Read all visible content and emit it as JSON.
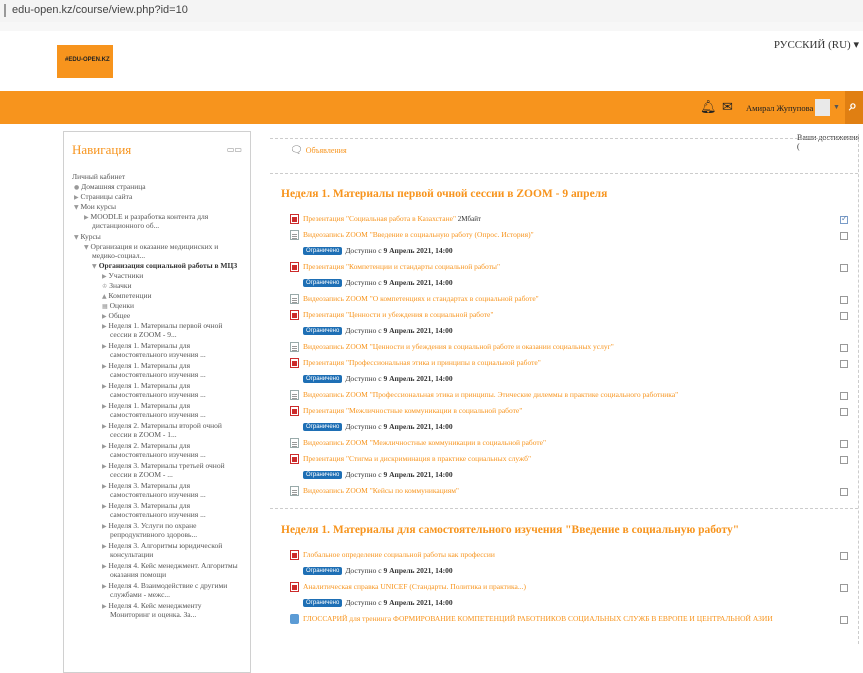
{
  "browser": {
    "url": "edu-open.kz/course/view.php?id=10"
  },
  "header": {
    "logo_text": "#EDU-OPEN.KZ",
    "language": "РУССКИЙ (RU) ▾"
  },
  "navbar": {
    "user_name": "Амирал Жупупова",
    "colors": {
      "accent": "#f7941d"
    }
  },
  "nav": {
    "title": "Навигация",
    "items": [
      {
        "label": "Личный кабинет",
        "arrow": ""
      },
      {
        "label": "Домашняя страница",
        "arrow": "●"
      },
      {
        "label": "Страницы сайта",
        "arrow": "▶"
      },
      {
        "label": "Мои курсы",
        "arrow": "▼"
      },
      {
        "label": "MOODLE и разработка контента для",
        "arrow": "▶"
      },
      {
        "label": "дистанционного об...",
        "arrow": ""
      },
      {
        "label": "Курсы",
        "arrow": "▼"
      },
      {
        "label": "Организация и оказание медицинских и",
        "arrow": "▼"
      },
      {
        "label": "медико-социал...",
        "arrow": ""
      },
      {
        "label": "Организация социальной работы в МЦЗ",
        "arrow": "▼"
      },
      {
        "label": "Участники",
        "arrow": "▶"
      },
      {
        "label": "Значки",
        "arrow": "♔"
      },
      {
        "label": "Компетенции",
        "arrow": "▲"
      },
      {
        "label": "Оценки",
        "arrow": "▦"
      },
      {
        "label": "Общее",
        "arrow": "▶"
      },
      {
        "label": "Неделя 1. Материалы первой очной",
        "arrow": "▶"
      },
      {
        "label": "сессии в ZOOM - 9...",
        "arrow": ""
      },
      {
        "label": "Неделя 1. Материалы для",
        "arrow": "▶"
      },
      {
        "label": "самостоятельного изучения ...",
        "arrow": ""
      },
      {
        "label": "Неделя 1. Материалы для",
        "arrow": "▶"
      },
      {
        "label": "самостоятельного изучения ...",
        "arrow": ""
      },
      {
        "label": "Неделя 1. Материалы для",
        "arrow": "▶"
      },
      {
        "label": "самостоятельного изучения ...",
        "arrow": ""
      },
      {
        "label": "Неделя 1. Материалы для",
        "arrow": "▶"
      },
      {
        "label": "самостоятельного изучения ...",
        "arrow": ""
      },
      {
        "label": "Неделя 2. Материалы второй очной",
        "arrow": "▶"
      },
      {
        "label": "сессии в ZOOM - 1...",
        "arrow": ""
      },
      {
        "label": "Неделя 2. Материалы для",
        "arrow": "▶"
      },
      {
        "label": "самостоятельного изучения ...",
        "arrow": ""
      },
      {
        "label": "Неделя 3. Материалы третьей очной",
        "arrow": "▶"
      },
      {
        "label": "сессии в ZOOM - ...",
        "arrow": ""
      },
      {
        "label": "Неделя 3. Материалы для",
        "arrow": "▶"
      },
      {
        "label": "самостоятельного изучения ...",
        "arrow": ""
      },
      {
        "label": "Неделя 3. Материалы для",
        "arrow": "▶"
      },
      {
        "label": "самостоятельного изучения ...",
        "arrow": ""
      },
      {
        "label": "Неделя 3. Услуги по охране",
        "arrow": "▶"
      },
      {
        "label": "репродуктивного здоровь...",
        "arrow": ""
      },
      {
        "label": "Неделя 3. Алгоритмы юридической",
        "arrow": "▶"
      },
      {
        "label": "консультации",
        "arrow": ""
      },
      {
        "label": "Неделя 4. Кейс менеджмент. Алгоритмы",
        "arrow": "▶"
      },
      {
        "label": "оказания помощи",
        "arrow": ""
      },
      {
        "label": "Неделя 4. Взаимодействие с другими",
        "arrow": "▶"
      },
      {
        "label": "службами - межс...",
        "arrow": ""
      },
      {
        "label": "Неделя 4. Кейс менеджменту",
        "arrow": "▶"
      },
      {
        "label": "Мониторинг и оценка. За...",
        "arrow": ""
      }
    ]
  },
  "main": {
    "achievements": "Ваши достижения (",
    "announcements": "Объявления",
    "sections": [
      {
        "title": "Неделя 1. Материалы первой очной сессии в ZOOM - 9 апреля",
        "activities": [
          {
            "icon": "pdf",
            "label": "Презентация \"Социальная работа в Казахстане\"",
            "size": "2Мбайт",
            "checked": true,
            "restricted": false
          },
          {
            "icon": "doc",
            "label": "Видеозапись ZOOM \"Введение в социальную работу (Опрос. История)\"",
            "checked": false,
            "restricted": true
          },
          {
            "icon": "pdf",
            "label": "Презентация \"Компетенции и стандарты социальной работы\"",
            "checked": false,
            "restricted": true
          },
          {
            "icon": "doc",
            "label": "Видеозапись ZOOM \"О компетенциях и стандартах в социальной работе\"",
            "checked": false,
            "restricted": false
          },
          {
            "icon": "pdf",
            "label": "Презентация \"Ценности и убеждения в социальной работе\"",
            "checked": false,
            "restricted": true
          },
          {
            "icon": "doc",
            "label": "Видеозапись ZOOM \"Ценности и убеждения в социальной работе и оказании социальных услуг\"",
            "checked": false,
            "restricted": false
          },
          {
            "icon": "pdf",
            "label": "Презентация \"Профессиональная этика и принципы в социальной работе\"",
            "checked": false,
            "restricted": true
          },
          {
            "icon": "doc",
            "label": "Видеозапись ZOOM \"Профессиональная этика и принципы. Этические дилеммы в практике социального работника\"",
            "checked": false,
            "restricted": false
          },
          {
            "icon": "pdf",
            "label": "Презентация \"Межличностные коммуникации в социальной работе\"",
            "checked": false,
            "restricted": true
          },
          {
            "icon": "doc",
            "label": "Видеозапись ZOOM \"Межличностные коммуникации в социальной работе\"",
            "checked": false,
            "restricted": false
          },
          {
            "icon": "pdf",
            "label": "Презентация \"Стигма и дискриминация в практике социальных служб\"",
            "checked": false,
            "restricted": true
          },
          {
            "icon": "doc",
            "label": "Видеозапись ZOOM \"Кейсы по коммуникациям\"",
            "checked": false,
            "restricted": false
          }
        ]
      },
      {
        "title": "Неделя 1. Материалы для самостоятельного изучения \"Введение в социальную работу\"",
        "activities": [
          {
            "icon": "pdf",
            "label": "Глобальное определение социальной работы как профессии",
            "checked": false,
            "restricted": true
          },
          {
            "icon": "pdf",
            "label": "Аналитическая справка UNICEF (Стандарты. Политика и практика...)",
            "checked": false,
            "restricted": true
          },
          {
            "icon": "gls",
            "label": "ГЛОССАРИЙ для тренинга ФОРМИРОВАНИЕ КОМПЕТЕНЦИЙ РАБОТНИКОВ СОЦИАЛЬНЫХ СЛУЖБ В ЕВРОПЕ И ЦЕНТРАЛЬНОЙ АЗИИ",
            "checked": false,
            "restricted": false
          }
        ]
      }
    ],
    "restriction": {
      "badge": "Ограничено",
      "text": "Доступно с",
      "date": "9 Апрель 2021, 14:00"
    }
  }
}
